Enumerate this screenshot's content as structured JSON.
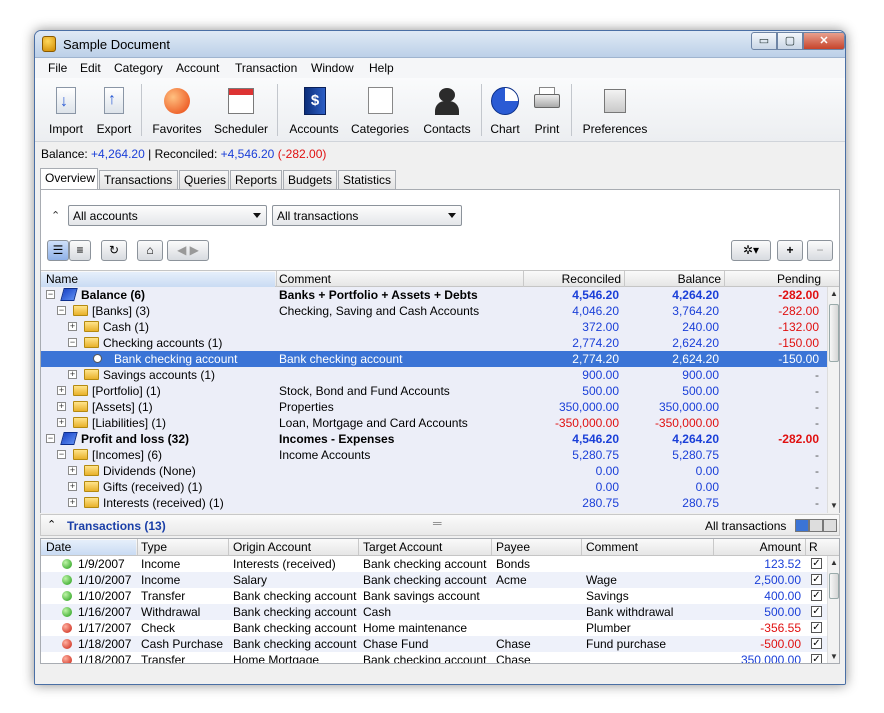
{
  "window": {
    "title": "Sample Document",
    "controls": {
      "min": "▭",
      "max": "▢",
      "close": "✕"
    }
  },
  "menu": [
    "File",
    "Edit",
    "Category",
    "Account",
    "Transaction",
    "Window",
    "Help"
  ],
  "toolbar": {
    "import": "Import",
    "export": "Export",
    "favorites": "Favorites",
    "scheduler": "Scheduler",
    "accounts": "Accounts",
    "categories": "Categories",
    "contacts": "Contacts",
    "chart": "Chart",
    "print": "Print",
    "preferences": "Preferences"
  },
  "balance": {
    "label": "Balance:",
    "value": "+4,264.20",
    "sep": "|",
    "reconciled_label": "Reconciled:",
    "reconciled": "+4,546.20",
    "pending": "(-282.00)"
  },
  "tabs": [
    "Overview",
    "Transactions",
    "Queries",
    "Reports",
    "Budgets",
    "Statistics"
  ],
  "filters": {
    "accounts": "All accounts",
    "transactions": "All transactions"
  },
  "tree": {
    "headers": {
      "name": "Name",
      "comment": "Comment",
      "reconciled": "Reconciled",
      "balance": "Balance",
      "pending": "Pending"
    },
    "rows": [
      {
        "name": "Balance (6)",
        "comment": "Banks + Portfolio + Assets + Debts",
        "reconciled": "4,546.20",
        "balance": "4,264.20",
        "pending": "-282.00"
      },
      {
        "name": "[Banks] (3)",
        "comment": "Checking, Saving and Cash Accounts",
        "reconciled": "4,046.20",
        "balance": "3,764.20",
        "pending": "-282.00"
      },
      {
        "name": "Cash (1)",
        "comment": "",
        "reconciled": "372.00",
        "balance": "240.00",
        "pending": "-132.00"
      },
      {
        "name": "Checking accounts (1)",
        "comment": "",
        "reconciled": "2,774.20",
        "balance": "2,624.20",
        "pending": "-150.00"
      },
      {
        "name": "Bank checking account",
        "comment": "Bank checking account",
        "reconciled": "2,774.20",
        "balance": "2,624.20",
        "pending": "-150.00"
      },
      {
        "name": "Savings accounts (1)",
        "comment": "",
        "reconciled": "900.00",
        "balance": "900.00",
        "pending": "-"
      },
      {
        "name": "[Portfolio] (1)",
        "comment": "Stock, Bond and Fund Accounts",
        "reconciled": "500.00",
        "balance": "500.00",
        "pending": "-"
      },
      {
        "name": "[Assets] (1)",
        "comment": "Properties",
        "reconciled": "350,000.00",
        "balance": "350,000.00",
        "pending": "-"
      },
      {
        "name": "[Liabilities] (1)",
        "comment": "Loan, Mortgage and Card Accounts",
        "reconciled": "-350,000.00",
        "balance": "-350,000.00",
        "pending": "-"
      },
      {
        "name": "Profit and loss (32)",
        "comment": "Incomes - Expenses",
        "reconciled": "4,546.20",
        "balance": "4,264.20",
        "pending": "-282.00"
      },
      {
        "name": "[Incomes] (6)",
        "comment": "Income Accounts",
        "reconciled": "5,280.75",
        "balance": "5,280.75",
        "pending": "-"
      },
      {
        "name": "Dividends (None)",
        "comment": "",
        "reconciled": "0.00",
        "balance": "0.00",
        "pending": "-"
      },
      {
        "name": "Gifts (received) (1)",
        "comment": "",
        "reconciled": "0.00",
        "balance": "0.00",
        "pending": "-"
      },
      {
        "name": "Interests (received) (1)",
        "comment": "",
        "reconciled": "280.75",
        "balance": "280.75",
        "pending": "-"
      }
    ]
  },
  "transactions": {
    "title": "Transactions (13)",
    "filter": "All transactions",
    "headers": {
      "date": "Date",
      "type": "Type",
      "origin": "Origin Account",
      "target": "Target Account",
      "payee": "Payee",
      "comment": "Comment",
      "amount": "Amount",
      "r": "R"
    },
    "rows": [
      {
        "date": "1/9/2007",
        "type": "Income",
        "origin": "Interests (received)",
        "target": "Bank checking account",
        "payee": "Bonds",
        "comment": "",
        "amount": "123.52",
        "status": "green"
      },
      {
        "date": "1/10/2007",
        "type": "Income",
        "origin": "Salary",
        "target": "Bank checking account",
        "payee": "Acme",
        "comment": "Wage",
        "amount": "2,500.00",
        "status": "green"
      },
      {
        "date": "1/10/2007",
        "type": "Transfer",
        "origin": "Bank checking account",
        "target": "Bank savings account",
        "payee": "",
        "comment": "Savings",
        "amount": "400.00",
        "status": "green"
      },
      {
        "date": "1/16/2007",
        "type": "Withdrawal",
        "origin": "Bank checking account",
        "target": "Cash",
        "payee": "",
        "comment": "Bank withdrawal",
        "amount": "500.00",
        "status": "green"
      },
      {
        "date": "1/17/2007",
        "type": "Check",
        "origin": "Bank checking account",
        "target": "Home maintenance",
        "payee": "",
        "comment": "Plumber",
        "amount": "-356.55",
        "status": "red"
      },
      {
        "date": "1/18/2007",
        "type": "Cash Purchase",
        "origin": "Bank checking account",
        "target": "Chase Fund",
        "payee": "Chase",
        "comment": "Fund purchase",
        "amount": "-500.00",
        "status": "red"
      },
      {
        "date": "1/18/2007",
        "type": "Transfer",
        "origin": "Home Mortgage",
        "target": "Bank checking account",
        "payee": "Chase",
        "comment": "",
        "amount": "350,000.00",
        "status": "red"
      }
    ]
  },
  "colors": {
    "positive": "#1a3fd8",
    "negative": "#e01010",
    "selection": "#3b74d6"
  }
}
